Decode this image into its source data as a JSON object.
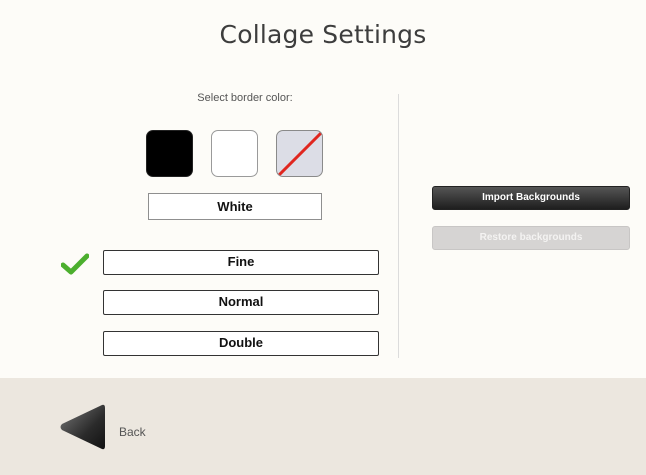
{
  "header": {
    "title": "Collage Settings"
  },
  "border_color": {
    "prompt": "Select border color:",
    "swatches": [
      {
        "name": "black",
        "color": "#000000"
      },
      {
        "name": "white",
        "color": "#ffffff"
      },
      {
        "name": "none",
        "color": "#dcdde6"
      }
    ],
    "selected_name": "White"
  },
  "border_style": {
    "selected": "Fine",
    "options": [
      "Fine",
      "Normal",
      "Double"
    ]
  },
  "backgrounds": {
    "import_label": "Import Backgrounds",
    "restore_label": "Restore backgrounds"
  },
  "footer": {
    "back_label": "Back"
  },
  "colors": {
    "accent_check": "#4caf2e",
    "footer_bg": "#ece7df"
  }
}
